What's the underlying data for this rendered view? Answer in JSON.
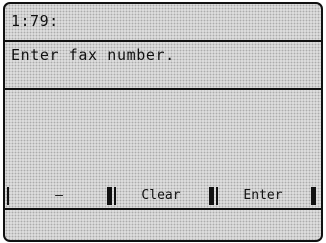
{
  "screen": {
    "header": "1:79:",
    "prompt": "Enter fax number.",
    "input_value": ""
  },
  "softkeys": [
    {
      "label": "–"
    },
    {
      "label": "Clear"
    },
    {
      "label": "Enter"
    }
  ]
}
